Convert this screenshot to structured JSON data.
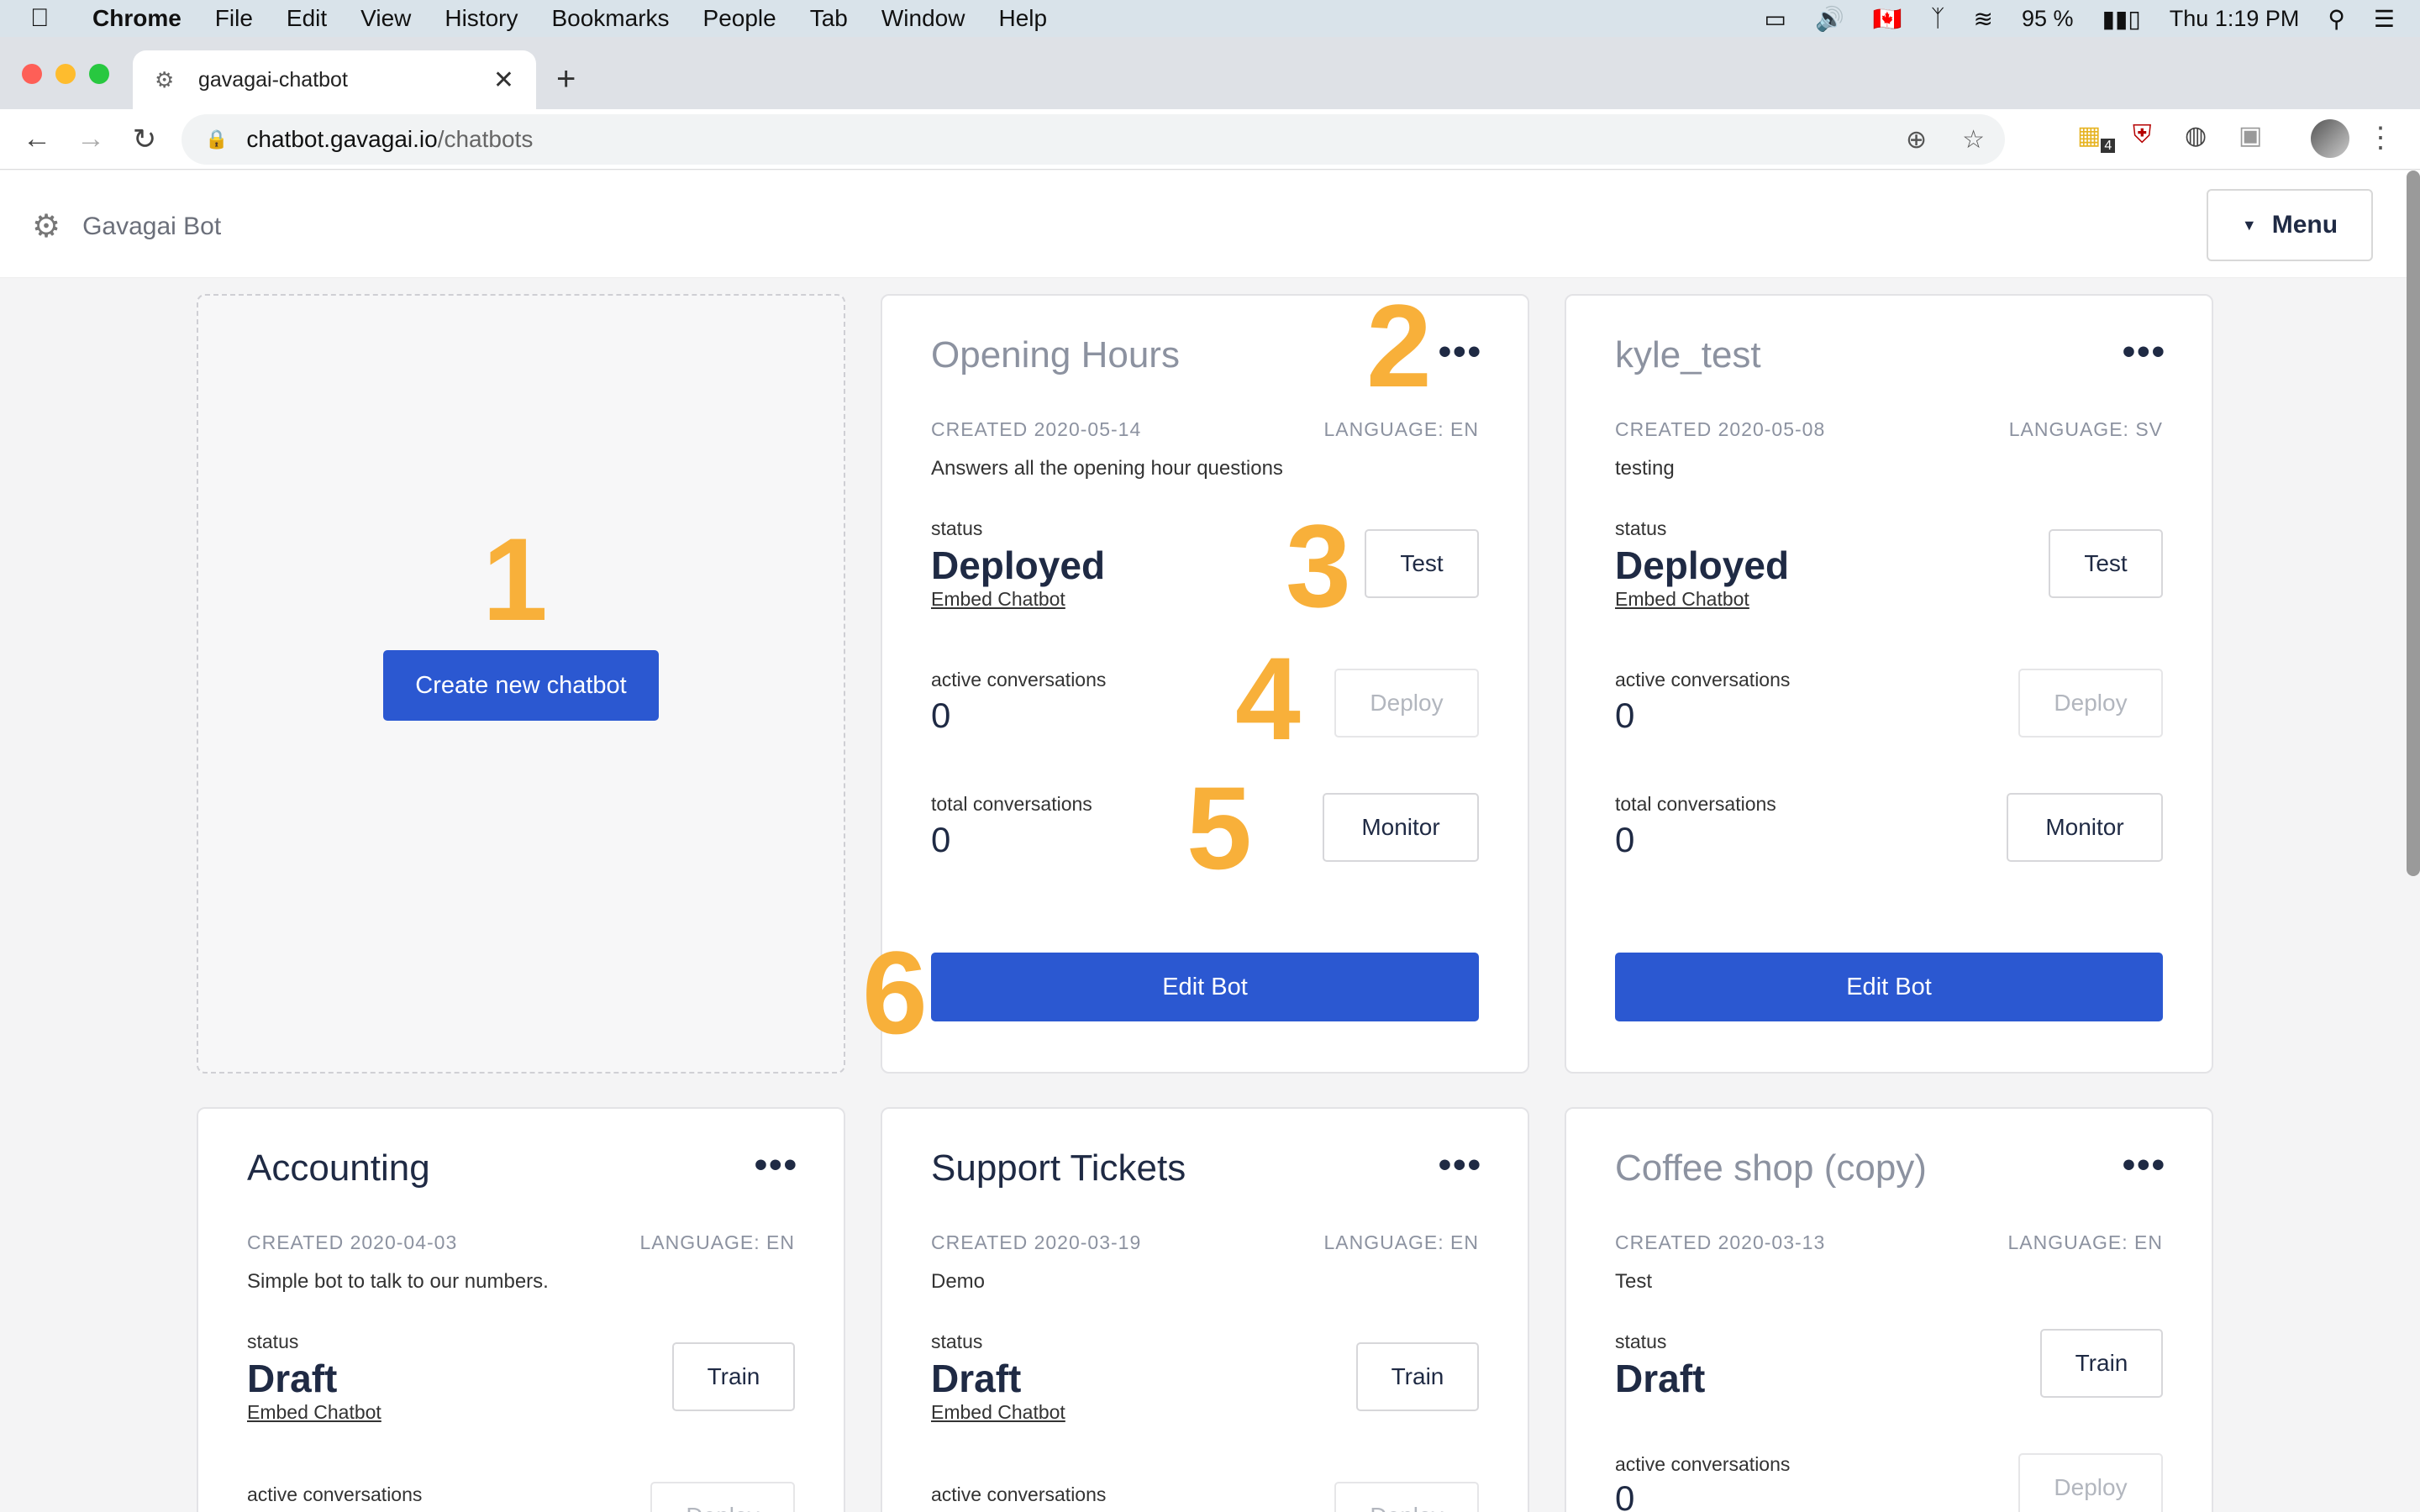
{
  "menubar": {
    "items": [
      "Chrome",
      "File",
      "Edit",
      "View",
      "History",
      "Bookmarks",
      "People",
      "Tab",
      "Window",
      "Help"
    ],
    "battery": "95 %",
    "clock": "Thu 1:19 PM"
  },
  "browser": {
    "tab_title": "gavagai-chatbot",
    "url_host": "chatbot.gavagai.io",
    "url_path": "/chatbots",
    "ext_badge": "4"
  },
  "app": {
    "brand": "Gavagai Bot",
    "menu_label": "Menu",
    "create_label": "Create new chatbot"
  },
  "labels": {
    "status": "status",
    "embed": "Embed Chatbot",
    "active": "active conversations",
    "total": "total conversations",
    "test": "Test",
    "train": "Train",
    "deploy": "Deploy",
    "monitor": "Monitor",
    "edit": "Edit Bot"
  },
  "annotations": [
    "1",
    "2",
    "3",
    "4",
    "5",
    "6"
  ],
  "bots": [
    {
      "name": "Opening Hours",
      "created": "CREATED 2020-05-14",
      "language": "LANGUAGE: EN",
      "description": "Answers all the opening hour questions",
      "status": "Deployed",
      "active": "0",
      "total": "0"
    },
    {
      "name": "kyle_test",
      "created": "CREATED 2020-05-08",
      "language": "LANGUAGE: SV",
      "description": "testing",
      "status": "Deployed",
      "active": "0",
      "total": "0"
    },
    {
      "name": "Accounting",
      "created": "CREATED 2020-04-03",
      "language": "LANGUAGE: EN",
      "description": "Simple bot to talk to our numbers.",
      "status": "Draft"
    },
    {
      "name": "Support Tickets",
      "created": "CREATED 2020-03-19",
      "language": "LANGUAGE: EN",
      "description": "Demo",
      "status": "Draft"
    },
    {
      "name": "Coffee shop (copy)",
      "created": "CREATED 2020-03-13",
      "language": "LANGUAGE: EN",
      "description": "Test",
      "status": "Draft",
      "active": "0"
    }
  ]
}
